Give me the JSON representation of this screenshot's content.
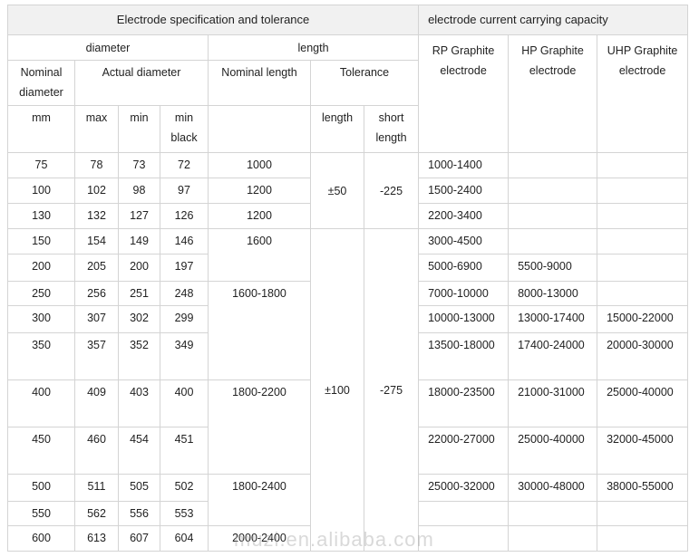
{
  "headers": {
    "spec_title": "Electrode specification and tolerance",
    "capacity_title": "electrode current carrying capacity",
    "diameter": "diameter",
    "length": "length",
    "nominal_diameter": "Nominal diameter",
    "actual_diameter": "Actual diameter",
    "nominal_length": "Nominal length",
    "tolerance": "Tolerance",
    "rp": "RP Graphite electrode",
    "hp": "HP Graphite electrode",
    "uhp": "UHP Graphite electrode",
    "mm": "mm",
    "max": "max",
    "min": "min",
    "min_black": "min black",
    "tol_length": "length",
    "short_length": "short length"
  },
  "groups": {
    "length_1000": "1000",
    "length_1200a": "1200",
    "length_1200b": "1200",
    "length_1600": "1600",
    "length_1600_1800": "1600-1800",
    "length_1800_2200": "1800-2200",
    "length_1800_2400": "1800-2400",
    "length_2000_2400": "2000-2400",
    "tol_small_length": "±50",
    "tol_small_short": "-225",
    "tol_large_length": "±100",
    "tol_large_short": "-275"
  },
  "rows": [
    {
      "nominal": "75",
      "max": "78",
      "min": "73",
      "min_black": "72",
      "rp": "1000-1400",
      "hp": "",
      "uhp": ""
    },
    {
      "nominal": "100",
      "max": "102",
      "min": "98",
      "min_black": "97",
      "rp": "1500-2400",
      "hp": "",
      "uhp": ""
    },
    {
      "nominal": "130",
      "max": "132",
      "min": "127",
      "min_black": "126",
      "rp": "2200-3400",
      "hp": "",
      "uhp": ""
    },
    {
      "nominal": "150",
      "max": "154",
      "min": "149",
      "min_black": "146",
      "rp": "3000-4500",
      "hp": "",
      "uhp": ""
    },
    {
      "nominal": "200",
      "max": "205",
      "min": "200",
      "min_black": "197",
      "rp": "5000-6900",
      "hp": "5500-9000",
      "uhp": ""
    },
    {
      "nominal": "250",
      "max": "256",
      "min": "251",
      "min_black": "248",
      "rp": "7000-10000",
      "hp": "8000-13000",
      "uhp": ""
    },
    {
      "nominal": "300",
      "max": "307",
      "min": "302",
      "min_black": "299",
      "rp": "10000-13000",
      "hp": "13000-17400",
      "uhp": "15000-22000"
    },
    {
      "nominal": "350",
      "max": "357",
      "min": "352",
      "min_black": "349",
      "rp": "13500-18000",
      "hp": "17400-24000",
      "uhp": "20000-30000"
    },
    {
      "nominal": "400",
      "max": "409",
      "min": "403",
      "min_black": "400",
      "rp": "18000-23500",
      "hp": "21000-31000",
      "uhp": "25000-40000"
    },
    {
      "nominal": "450",
      "max": "460",
      "min": "454",
      "min_black": "451",
      "rp": "22000-27000",
      "hp": "25000-40000",
      "uhp": "32000-45000"
    },
    {
      "nominal": "500",
      "max": "511",
      "min": "505",
      "min_black": "502",
      "rp": "25000-32000",
      "hp": "30000-48000",
      "uhp": "38000-55000"
    },
    {
      "nominal": "550",
      "max": "562",
      "min": "556",
      "min_black": "553",
      "rp": "",
      "hp": "",
      "uhp": ""
    },
    {
      "nominal": "600",
      "max": "613",
      "min": "607",
      "min_black": "604",
      "rp": "",
      "hp": "",
      "uhp": ""
    }
  ],
  "watermark": "muzi.en.alibaba.com"
}
